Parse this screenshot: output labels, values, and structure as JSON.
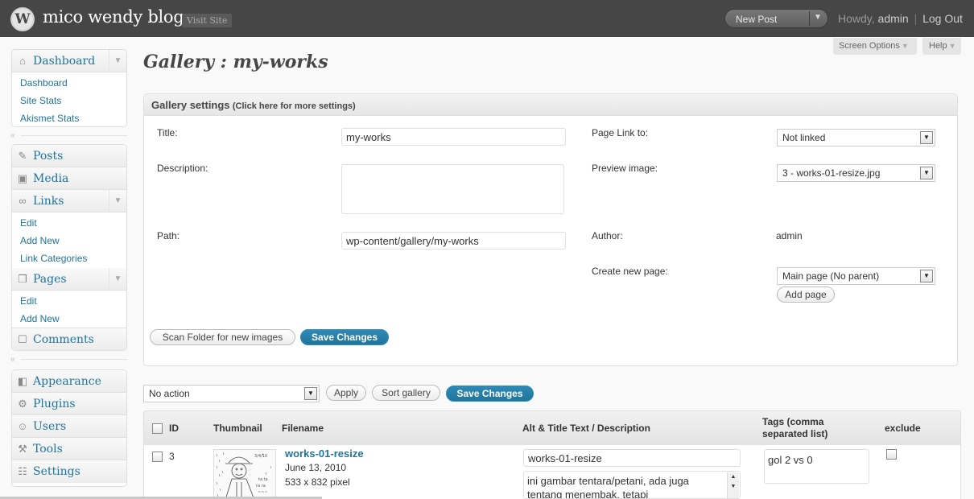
{
  "header": {
    "logo_letter": "W",
    "site_title": "mico wendy blog",
    "visit_site": "Visit Site",
    "new_post": "New Post",
    "howdy": "Howdy,",
    "user": "admin",
    "separator": "|",
    "logout": "Log Out"
  },
  "tabs": {
    "screen_options": "Screen Options",
    "help": "Help"
  },
  "sidebar": {
    "dashboard": {
      "label": "Dashboard",
      "items": [
        "Dashboard",
        "Site Stats",
        "Akismet Stats"
      ]
    },
    "posts": "Posts",
    "media": "Media",
    "links": {
      "label": "Links",
      "items": [
        "Edit",
        "Add New",
        "Link Categories"
      ]
    },
    "pages": {
      "label": "Pages",
      "items": [
        "Edit",
        "Add New"
      ]
    },
    "comments": "Comments",
    "appearance": "Appearance",
    "plugins": "Plugins",
    "users": "Users",
    "tools": "Tools",
    "settings": "Settings"
  },
  "page_title": "Gallery : my-works",
  "gallery_settings": {
    "heading": "Gallery settings",
    "more_link": "(Click here for more settings)",
    "title_label": "Title:",
    "title_value": "my-works",
    "description_label": "Description:",
    "description_value": "",
    "path_label": "Path:",
    "path_value": "wp-content/gallery/my-works",
    "page_link_label": "Page Link to:",
    "page_link_value": "Not linked",
    "preview_label": "Preview image:",
    "preview_value": "3 - works-01-resize.jpg",
    "author_label": "Author:",
    "author_value": "admin",
    "create_page_label": "Create new page:",
    "create_page_value": "Main page (No parent)",
    "add_page": "Add page",
    "scan_folder": "Scan Folder for new images",
    "save_changes": "Save Changes"
  },
  "bulk": {
    "action": "No action",
    "apply": "Apply",
    "sort_gallery": "Sort gallery",
    "save_changes": "Save Changes"
  },
  "table": {
    "columns": {
      "id": "ID",
      "thumbnail": "Thumbnail",
      "filename": "Filename",
      "alt": "Alt & Title Text / Description",
      "tags_line1": "Tags (comma",
      "tags_line2": "separated list)",
      "exclude": "exclude"
    },
    "rows": [
      {
        "id": "3",
        "filename": "works-01-resize",
        "date": "June 13, 2010",
        "dimensions": "533 x 832 pixel",
        "alt_text": "works-01-resize",
        "description": "ini gambar tentara/petani, ada juga tentang menembak, tetapi",
        "tags": "gol 2 vs 0"
      }
    ]
  }
}
